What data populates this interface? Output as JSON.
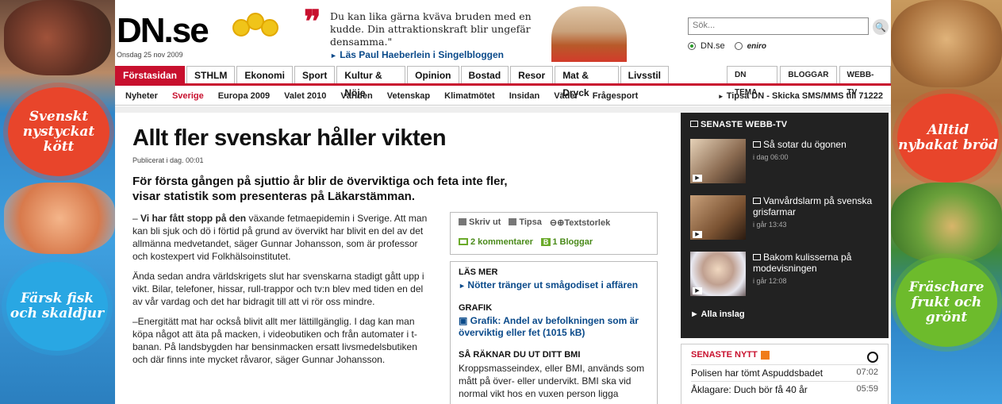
{
  "left_ad": {
    "texts": [
      "Svenskt nystyckat kött",
      "Färsk fisk och skaldjur"
    ]
  },
  "right_ad": {
    "texts": [
      "Alltid nybakat bröd",
      "Fräschare frukt och grönt"
    ]
  },
  "header": {
    "logo": "DN.se",
    "date": "Onsdag 25 nov 2009",
    "quote": "Du kan lika gärna kväva bruden med en kudde. Din attraktionskraft blir ungefär densamma.\"",
    "quote_link": "Läs Paul Haeberlein i Singelbloggen",
    "search_placeholder": "Sök...",
    "search_options": [
      "DN.se",
      "eniro"
    ],
    "selected_option": "DN.se"
  },
  "nav": {
    "items": [
      "Förstasidan",
      "STHLM",
      "Ekonomi",
      "Sport",
      "Kultur & Nöje",
      "Opinion",
      "Bostad",
      "Resor",
      "Mat & Dryck",
      "Livsstil"
    ],
    "active": "Förstasidan",
    "right_items": [
      "DN TEMA",
      "BLOGGAR",
      "WEBB-TV"
    ]
  },
  "subnav": {
    "items": [
      "Nyheter",
      "Sverige",
      "Europa 2009",
      "Valet 2010",
      "Världen",
      "Vetenskap",
      "Klimatmötet",
      "Insidan",
      "Väder",
      "Frågesport"
    ],
    "active": "Sverige",
    "tip": "Tipsa DN - Skicka SMS/MMS till 71222"
  },
  "article": {
    "headline": "Allt fler svenskar håller vikten",
    "published": "Publicerat i dag. 00:01",
    "ingress": "För första gången på sjuttio år blir de överviktiga och feta inte fler, visar statistik som presenteras på Läkarstämman.",
    "p1_bold": "Vi har fått stopp på den",
    "p1_dash": "– ",
    "p1_rest": " växande fetmaepidemin i Sverige. Att man kan bli sjuk och dö i förtid på grund av övervikt har blivit en del av det allmänna medvetandet, säger Gunnar Johansson, som är professor och kostexpert vid Folkhälsoinstitutet.",
    "p2": "Ända sedan andra världskrigets slut har svenskarna stadigt gått upp i vikt. Bilar, telefoner, hissar, rull-trappor och tv:n blev med tiden en del av vår vardag och det har bidragit till att vi rör oss mindre.",
    "p3": "–Energitätt mat har också blivit allt mer lättillgänglig. I dag kan man köpa något att äta på macken, i videobutiken och från automater i t-banan. På landsbygden har bensinmacken ersatt livsmedelsbutiken och där finns inte mycket råvaror, säger Gunnar Johansson."
  },
  "tools": {
    "print": "Skriv ut",
    "tip": "Tipsa",
    "textsize": "Textstorlek",
    "comments": "2 kommentarer",
    "blogs": "1 Bloggar"
  },
  "related": {
    "read_more_head": "LÄS MER",
    "read_more_link": "Nötter tränger ut smågodiset i affären",
    "graphic_head": "GRAFIK",
    "graphic_link": "Grafik: Andel av befolkningen som är överviktig eller fet (1015 kB)",
    "bmi_head": "SÅ RÄKNAR DU UT DITT BMI",
    "bmi_text": "Kroppsmasseindex, eller BMI, används som mått på över- eller undervikt. BMI ska vid normal vikt hos en vuxen person ligga"
  },
  "webtv": {
    "title": "SENASTE WEBB-TV",
    "videos": [
      {
        "title": "Så sotar du ögonen",
        "time": "i dag 06:00"
      },
      {
        "title": "Vanvårdslarm på svenska grisfarmar",
        "time": "i går 13:43"
      },
      {
        "title": "Bakom kulisserna på modevisningen",
        "time": "i går 12:08"
      }
    ],
    "all_link": "Alla inslag"
  },
  "news": {
    "title": "SENASTE NYTT",
    "rows": [
      {
        "text": "Polisen har tömt Aspuddsbadet",
        "time": "07:02"
      },
      {
        "text": "Åklagare: Duch bör få 40 år",
        "time": "05:59"
      }
    ]
  },
  "colors": {
    "brand_red": "#c8102e",
    "link_blue": "#0a4a8a",
    "webtv_bg": "#222222"
  }
}
